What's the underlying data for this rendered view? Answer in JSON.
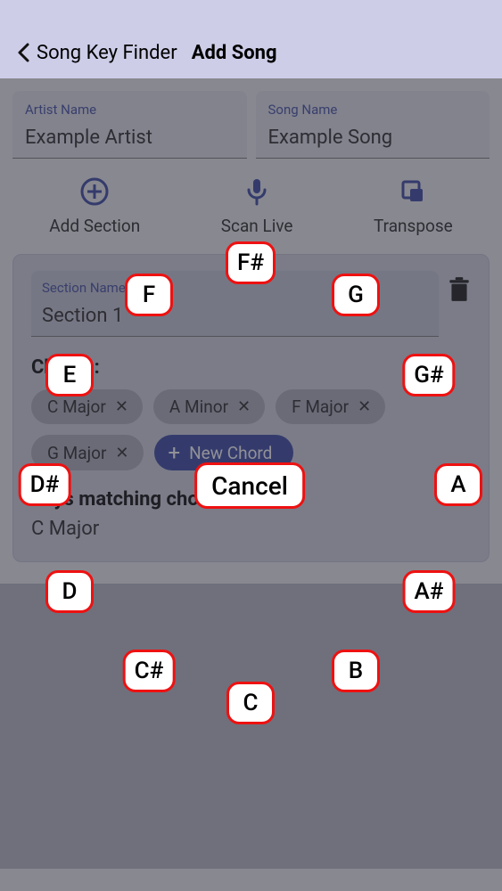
{
  "header": {
    "back_label": "Song Key Finder",
    "title": "Add Song"
  },
  "fields": {
    "artist_label": "Artist Name",
    "artist_value": "Example Artist",
    "song_label": "Song Name",
    "song_value": "Example Song"
  },
  "toolbar": {
    "add_section_label": "Add Section",
    "scan_live_label": "Scan Live",
    "transpose_label": "Transpose"
  },
  "section": {
    "name_label": "Section Name",
    "name_value": "Section 1",
    "chords_label": "Chords:",
    "chords": [
      "C Major",
      "A Minor",
      "F Major",
      "G Major"
    ],
    "new_chord_label": "New Chord",
    "matching_label": "Keys matching chords:",
    "matching_value": "C Major"
  },
  "radial": {
    "cancel_label": "Cancel",
    "notes": [
      "C",
      "C#",
      "D",
      "D#",
      "E",
      "F",
      "F#",
      "G",
      "G#",
      "A",
      "A#",
      "B"
    ]
  },
  "colors": {
    "accent": "#31409f",
    "highlight": "#e11"
  }
}
